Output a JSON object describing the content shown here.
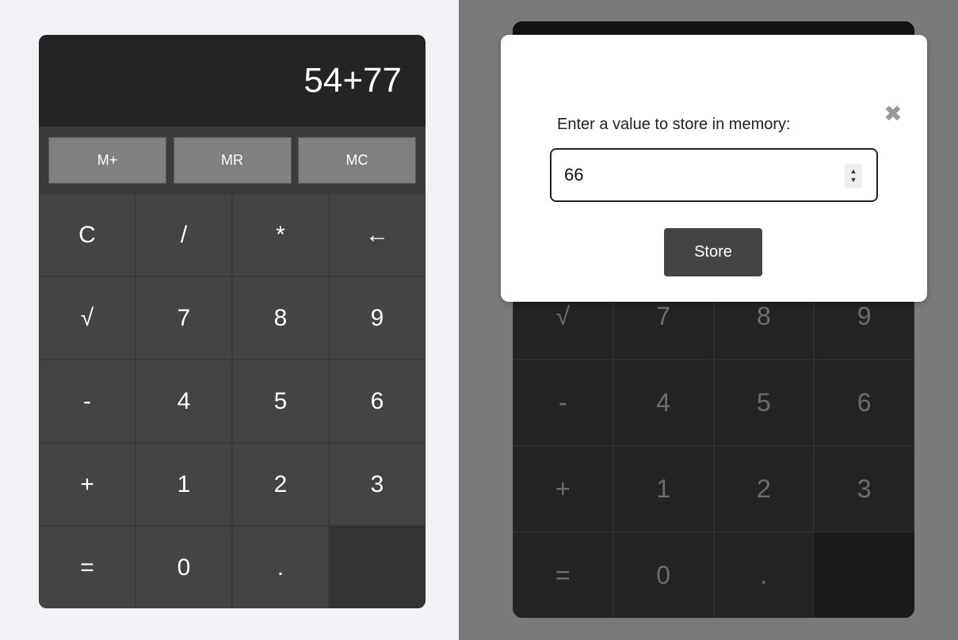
{
  "calc_left": {
    "display": "54+77",
    "memory": [
      "M+",
      "MR",
      "MC"
    ],
    "keys": [
      "C",
      "/",
      "*",
      "←",
      "√",
      "7",
      "8",
      "9",
      "-",
      "4",
      "5",
      "6",
      "+",
      "1",
      "2",
      "3",
      "=",
      "0",
      ".",
      ""
    ]
  },
  "calc_right": {
    "keys": [
      "√",
      "7",
      "8",
      "9",
      "-",
      "4",
      "5",
      "6",
      "+",
      "1",
      "2",
      "3",
      "=",
      "0",
      ".",
      ""
    ]
  },
  "modal": {
    "prompt": "Enter a value to store in memory:",
    "close": "✖",
    "input_value": "66",
    "store_label": "Store"
  },
  "colors": {
    "display_bg": "#242424",
    "key_bg": "#444444",
    "memory_btn_bg": "#808080",
    "overlay": "#7a7a7a",
    "store_btn_bg": "#444444"
  }
}
